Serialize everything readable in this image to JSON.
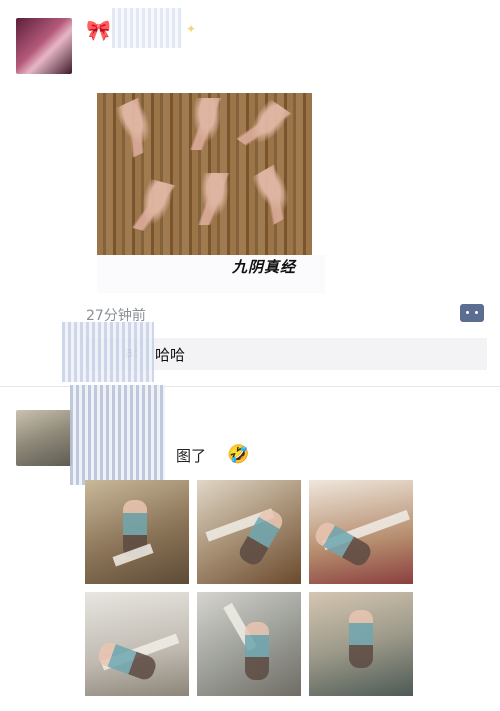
{
  "post1": {
    "photo_caption": "九阴真经"
  },
  "meta": {
    "time": "27分钟前"
  },
  "comment": {
    "name_suffix": "a:",
    "text": "哈哈"
  },
  "post2": {
    "text_fragment": "图了"
  },
  "colors": {
    "link": "#576b95",
    "comment_bg": "#f3f3f5"
  },
  "icons": [
    "comment-icon",
    "emoji-icon"
  ]
}
